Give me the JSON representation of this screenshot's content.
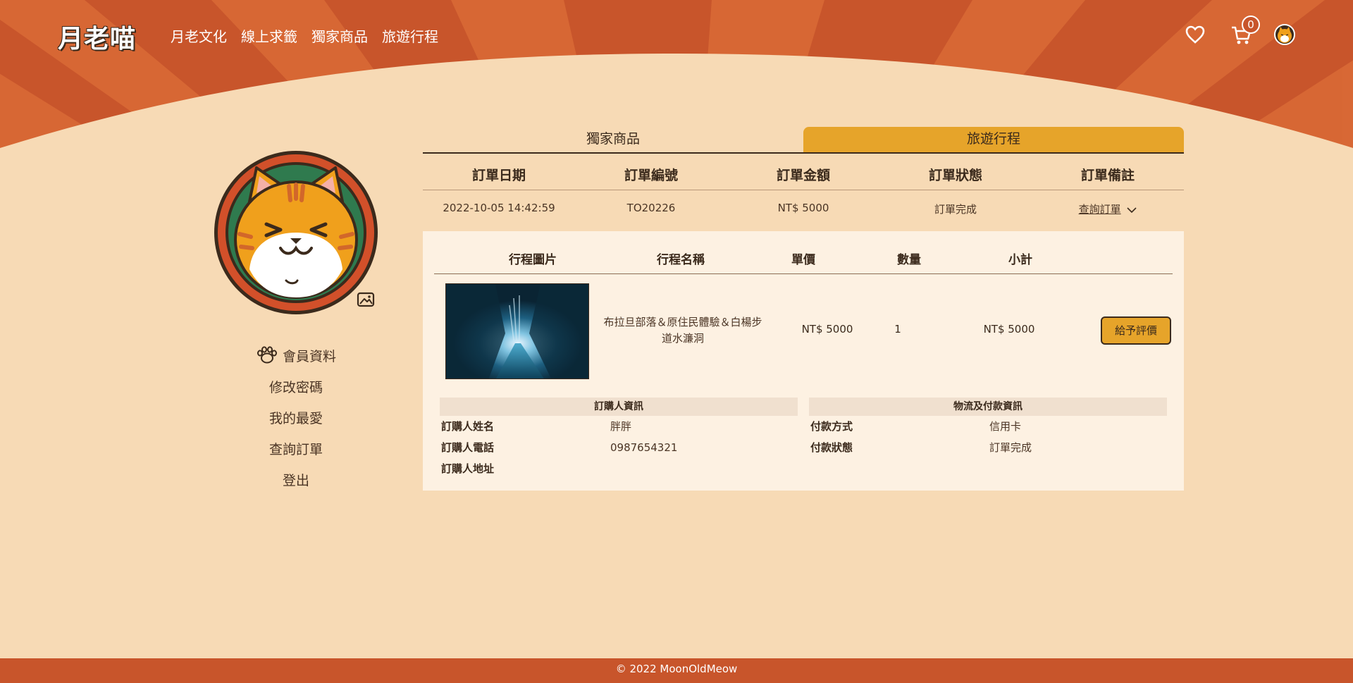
{
  "brand": {
    "logo": "月老喵"
  },
  "nav": {
    "items": [
      "月老文化",
      "線上求籤",
      "獨家商品",
      "旅遊行程"
    ]
  },
  "header": {
    "cart_count": "0"
  },
  "sidebar": {
    "items": [
      "會員資料",
      "修改密碼",
      "我的最愛",
      "查詢訂單",
      "登出"
    ]
  },
  "tabs": [
    "獨家商品",
    "旅遊行程"
  ],
  "active_tab": "旅遊行程",
  "order_table": {
    "headers": [
      "訂單日期",
      "訂單編號",
      "訂單金額",
      "訂單狀態",
      "訂單備註"
    ],
    "row": {
      "date": "2022-10-05 14:42:59",
      "number": "TO20226",
      "amount": "NT$ 5000",
      "status": "訂單完成",
      "note_link": "查詢訂單"
    }
  },
  "detail": {
    "headers": [
      "行程圖片",
      "行程名稱",
      "單價",
      "數量",
      "小計"
    ],
    "item": {
      "name": "布拉旦部落＆原住民體驗＆白楊步道水濂洞",
      "price": "NT$ 5000",
      "qty": "1",
      "subtotal": "NT$ 5000",
      "review_button": "給予評價"
    },
    "buyer": {
      "title": "訂購人資訊",
      "rows": [
        {
          "label": "訂購人姓名",
          "value": "胖胖"
        },
        {
          "label": "訂購人電話",
          "value": "0987654321"
        },
        {
          "label": "訂購人地址",
          "value": ""
        }
      ]
    },
    "payment": {
      "title": "物流及付款資訊",
      "rows": [
        {
          "label": "付款方式",
          "value": "信用卡"
        },
        {
          "label": "付款狀態",
          "value": "訂單完成"
        }
      ]
    }
  },
  "footer": {
    "text": "© 2022 MoonOldMeow"
  },
  "colors": {
    "background": "#f7dab5",
    "header_orange": "#c8552b",
    "header_stripe": "#d96a36",
    "accent": "#e6a42a",
    "panel": "#fdf1e2",
    "text": "#3b2a1c"
  }
}
